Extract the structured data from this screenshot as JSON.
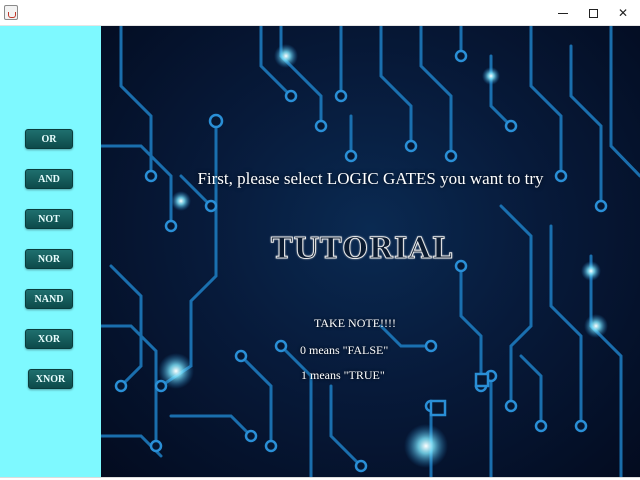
{
  "window": {
    "minimize_glyph": "",
    "maximize_glyph": "",
    "close_glyph": "✕"
  },
  "sidebar": {
    "gates": [
      "OR",
      "AND",
      "NOT",
      "NOR",
      "NAND",
      "XOR",
      "XNOR"
    ]
  },
  "main": {
    "headline": "First, please select LOGIC GATES you want to try",
    "tutorial_title": "TUTORIAL",
    "note_title": "TAKE NOTE!!!!",
    "note_false": "0 means \"FALSE\"",
    "note_true": "1 means \"TRUE\""
  },
  "colors": {
    "sidebar": "#7ef9ff",
    "button": "#1f6f6e",
    "circuit": "#1e7fc4",
    "glow": "#7fe8ff"
  },
  "icons": {
    "app": "java-app-icon",
    "minimize": "minimize-icon",
    "maximize": "maximize-icon",
    "close": "close-icon"
  }
}
